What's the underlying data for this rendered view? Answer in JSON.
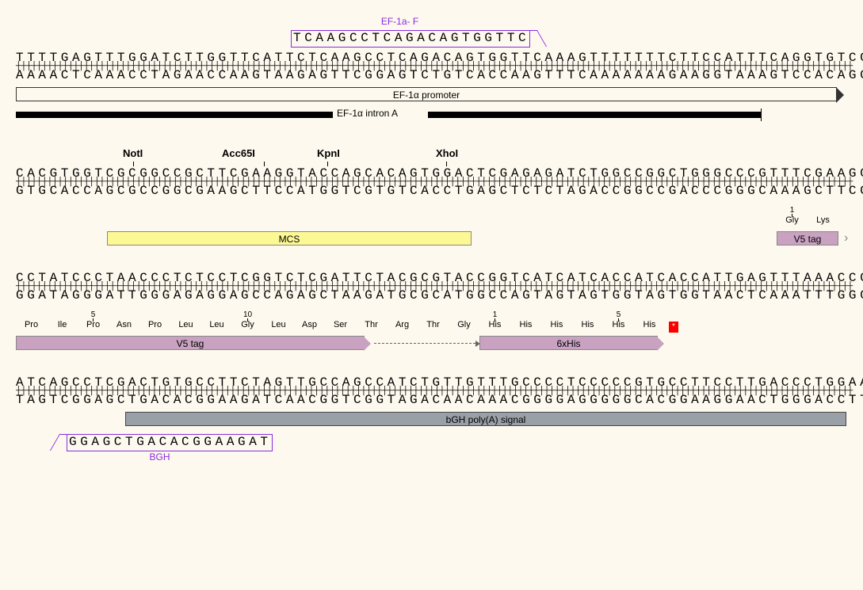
{
  "block1": {
    "primer_label": "EF-1a- F",
    "primer_seq": "TCAAGCCTCAGACAGTGGTTC",
    "top": "TTTTGAGTTTGGATCTTGGTTCATTCTCAAGCCTCAGACAGTGGTTCAAAGTTTTTTTCTTCCATTTCAGGTGTCGTGAA",
    "bottom": "AAAACTCAAACCTAGAACCAAGTAAGAGTTCGGAGTCTGTCACCAAGTTTCAAAAAAAGAAGGTAAAGTCCACAGCACTT",
    "promoter_label": "EF-1α promoter",
    "intron_label": "EF-1α intron A"
  },
  "block2": {
    "enzymes": [
      "NotI",
      "Acc65I",
      "KpnI",
      "XhoI"
    ],
    "top": "CACGTGGTCGCGGCCGCTTCGAAGGTACCAGCACAGTGGACTCGAGAGATCTGGCCGGCTGGGCCCGTTTCGAAGGTAAG",
    "bottom": "GTGCACCAGCGCCGGCGAAGCTTCCATGGTCGTGTCACCTGAGCTCTCTAGACCGGCCGACCCGGGCAAAGCTTCCATTC",
    "mcs_label": "MCS",
    "v5_label": "V5 tag",
    "aa": [
      "Gly",
      "Lys"
    ],
    "aa_nums": [
      "1"
    ]
  },
  "block3": {
    "top": "CCTATCCCTAACCCTCTCCTCGGTCTCGATTCTACGCGTACCGGTCATCATCACCATCACCATTGAGTTTAAACCCGCTG",
    "bottom": "GGATAGGGATTGGGAGAGGAGCCAGAGCTAAGATGCGCATGGCCAGTAGTAGTGGTAGTGGTAACTCAAATTTGGGCGAC",
    "aa": [
      "Pro",
      "Ile",
      "Pro",
      "Asn",
      "Pro",
      "Leu",
      "Leu",
      "Gly",
      "Leu",
      "Asp",
      "Ser",
      "Thr",
      "Arg",
      "Thr",
      "Gly",
      "His",
      "His",
      "His",
      "His",
      "His",
      "His"
    ],
    "aa_nums_left": [
      "5",
      "10"
    ],
    "aa_nums_right": [
      "1",
      "5"
    ],
    "v5_label": "V5 tag",
    "his_label": "6xHis",
    "stop": "*"
  },
  "block4": {
    "top": "ATCAGCCTCGACTGTGCCTTCTAGTTGCCAGCCATCTGTTGTTTGCCCCTCCCCCGTGCCTTCCTTGACCCTGGAAGGTG",
    "bottom": "TAGTCGGAGCTGACACGGAAGATCAACGGTCGGTAGACAACAAACGGGGAGGGGGCACGGAAGGAACTGGGACCTTCCAC",
    "polyA_label": "bGH poly(A) signal",
    "primer_seq": "GGAGCTGACACGGAAGAT",
    "primer_label": "BGH"
  }
}
